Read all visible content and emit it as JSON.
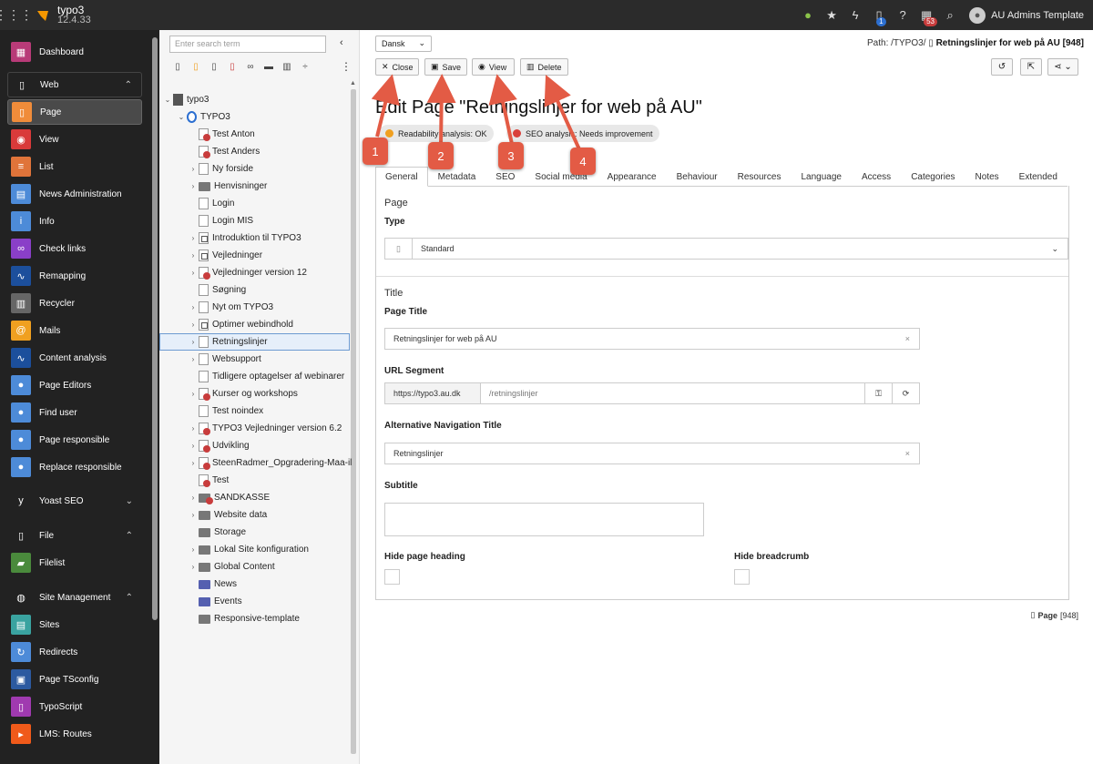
{
  "topbar": {
    "app_name": "typo3",
    "version": "12.4.33",
    "user": "AU Admins Template",
    "badge_files": "1",
    "badge_sched": "53"
  },
  "modules": [
    {
      "label": "Dashboard",
      "icon": "dashboard-icon",
      "color": "#b83b78"
    },
    {
      "label": "Web",
      "group": true
    },
    {
      "label": "Page",
      "icon": "page-icon",
      "color": "#f08c3a"
    },
    {
      "label": "View",
      "icon": "eye-icon",
      "color": "#d93a3a"
    },
    {
      "label": "List",
      "icon": "list-icon",
      "color": "#e0743a"
    },
    {
      "label": "News Administration",
      "icon": "news-icon",
      "color": "#4d8bd8"
    },
    {
      "label": "Info",
      "icon": "info-icon",
      "color": "#4d8bd8"
    },
    {
      "label": "Check links",
      "icon": "link-icon",
      "color": "#8a3fc8"
    },
    {
      "label": "Remapping",
      "icon": "wave-icon",
      "color": "#1c4f9c"
    },
    {
      "label": "Recycler",
      "icon": "trash-icon",
      "color": "#666666"
    },
    {
      "label": "Mails",
      "icon": "mail-icon",
      "color": "#f0a020"
    },
    {
      "label": "Content analysis",
      "icon": "wave-icon",
      "color": "#1c4f9c"
    },
    {
      "label": "Page Editors",
      "icon": "user-icon",
      "color": "#4d8bd8"
    },
    {
      "label": "Find user",
      "icon": "user-icon",
      "color": "#4d8bd8"
    },
    {
      "label": "Page responsible",
      "icon": "user-icon",
      "color": "#4d8bd8"
    },
    {
      "label": "Replace responsible",
      "icon": "user-icon",
      "color": "#4d8bd8"
    },
    {
      "label": "Yoast SEO",
      "group": true
    },
    {
      "label": "File",
      "group": true
    },
    {
      "label": "Filelist",
      "icon": "folder-icon",
      "color": "#4a8a3c"
    },
    {
      "label": "Site Management",
      "group": true
    },
    {
      "label": "Sites",
      "icon": "sites-icon",
      "color": "#3aa3a0"
    },
    {
      "label": "Redirects",
      "icon": "redirect-icon",
      "color": "#4d8bd8"
    },
    {
      "label": "Page TSconfig",
      "icon": "tsconfig-icon",
      "color": "#2c5aa0"
    },
    {
      "label": "TypoScript",
      "icon": "typoscript-icon",
      "color": "#a03ab0"
    },
    {
      "label": "LMS: Routes",
      "icon": "typo3-icon",
      "color": "#f05a1a"
    }
  ],
  "tree": {
    "search_placeholder": "Enter search term",
    "root": "typo3",
    "site": "TYPO3",
    "nodes": [
      {
        "label": "Test Anton",
        "type": "red",
        "toggle": false
      },
      {
        "label": "Test Anders",
        "type": "red",
        "toggle": false
      },
      {
        "label": "Ny forside",
        "type": "page",
        "toggle": true
      },
      {
        "label": "Henvisninger",
        "type": "folder",
        "toggle": true
      },
      {
        "label": "Login",
        "type": "page",
        "toggle": false
      },
      {
        "label": "Login MIS",
        "type": "page",
        "toggle": false
      },
      {
        "label": "Introduktion til TYPO3",
        "type": "link",
        "toggle": true
      },
      {
        "label": "Vejledninger",
        "type": "link",
        "toggle": true
      },
      {
        "label": "Vejledninger version 12",
        "type": "red",
        "toggle": true
      },
      {
        "label": "Søgning",
        "type": "page",
        "toggle": false
      },
      {
        "label": "Nyt om TYPO3",
        "type": "page",
        "toggle": true
      },
      {
        "label": "Optimer webindhold",
        "type": "link",
        "toggle": true
      },
      {
        "label": "Retningslinjer",
        "type": "page",
        "toggle": true,
        "selected": true
      },
      {
        "label": "Websupport",
        "type": "page",
        "toggle": true
      },
      {
        "label": "Tidligere optagelser af webinarer",
        "type": "page",
        "toggle": false
      },
      {
        "label": "Kurser og workshops",
        "type": "red",
        "toggle": true
      },
      {
        "label": "Test noindex",
        "type": "page",
        "toggle": false
      },
      {
        "label": "TYPO3 Vejledninger version 6.2",
        "type": "red",
        "toggle": true
      },
      {
        "label": "Udvikling",
        "type": "red",
        "toggle": true
      },
      {
        "label": "SteenRadmer_Opgradering-Maa-il",
        "type": "red",
        "toggle": true
      },
      {
        "label": "Test",
        "type": "red",
        "toggle": false
      },
      {
        "label": "SANDKASSE",
        "type": "folderred",
        "toggle": true
      },
      {
        "label": "Website data",
        "type": "folder",
        "toggle": true
      },
      {
        "label": "Storage",
        "type": "folder",
        "toggle": false
      },
      {
        "label": "Lokal Site konfiguration",
        "type": "folder",
        "toggle": true
      },
      {
        "label": "Global Content",
        "type": "folder",
        "toggle": true
      },
      {
        "label": "News",
        "type": "folderblue",
        "toggle": false
      },
      {
        "label": "Events",
        "type": "folderblue",
        "toggle": false
      },
      {
        "label": "Responsive-template",
        "type": "folder",
        "toggle": false
      }
    ]
  },
  "doc": {
    "language": "Dansk",
    "path_prefix": "Path: /TYPO3/",
    "path_page": "Retningslinjer for web på AU [948]",
    "buttons": {
      "close": "Close",
      "save": "Save",
      "view": "View",
      "delete": "Delete"
    },
    "title": "Edit Page \"Retningslinjer for web på AU\"",
    "readability": "Readability analysis: OK",
    "seo": "SEO analysis: Needs improvement",
    "tabs": [
      "General",
      "Metadata",
      "SEO",
      "Social media",
      "Appearance",
      "Behaviour",
      "Resources",
      "Language",
      "Access",
      "Categories",
      "Notes",
      "Extended"
    ],
    "sec_page": "Page",
    "type_label": "Type",
    "type_value": "Standard",
    "sec_title": "Title",
    "page_title_label": "Page Title",
    "page_title_value": "Retningslinjer for web på AU",
    "url_label": "URL Segment",
    "url_domain": "https://typo3.au.dk",
    "url_value": "/retningslinjer",
    "nav_title_label": "Alternative Navigation Title",
    "nav_title_value": "Retningslinjer",
    "subtitle_label": "Subtitle",
    "hide_heading_label": "Hide page heading",
    "hide_breadcrumb_label": "Hide breadcrumb",
    "footer_label": "Page",
    "footer_id": "[948]"
  },
  "annotations": [
    "1",
    "2",
    "3",
    "4"
  ],
  "colors": {
    "annotation": "#e35b45",
    "readability_dot": "#f0a020",
    "seo_dot": "#d9403a"
  }
}
